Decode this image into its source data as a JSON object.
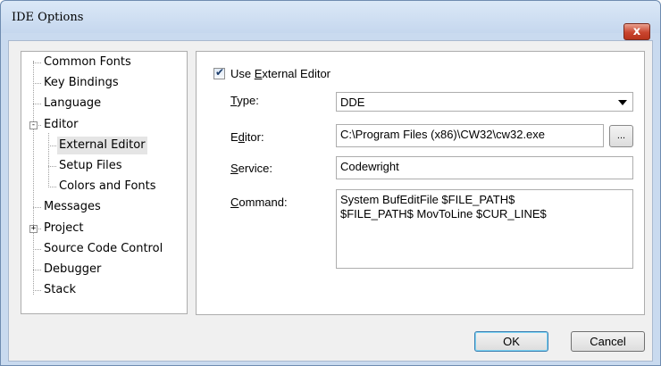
{
  "window": {
    "title": "IDE Options",
    "close_label": "x"
  },
  "tree": {
    "items": [
      {
        "label": "Common Fonts",
        "level": 0,
        "expander": ""
      },
      {
        "label": "Key Bindings",
        "level": 0,
        "expander": ""
      },
      {
        "label": "Language",
        "level": 0,
        "expander": ""
      },
      {
        "label": "Editor",
        "level": 0,
        "expander": "-"
      },
      {
        "label": "External Editor",
        "level": 1,
        "expander": "",
        "selected": true
      },
      {
        "label": "Setup Files",
        "level": 1,
        "expander": ""
      },
      {
        "label": "Colors and Fonts",
        "level": 1,
        "expander": ""
      },
      {
        "label": "Messages",
        "level": 0,
        "expander": ""
      },
      {
        "label": "Project",
        "level": 0,
        "expander": "+"
      },
      {
        "label": "Source Code Control",
        "level": 0,
        "expander": ""
      },
      {
        "label": "Debugger",
        "level": 0,
        "expander": ""
      },
      {
        "label": "Stack",
        "level": 0,
        "expander": ""
      }
    ]
  },
  "panel": {
    "use_external_editor": {
      "label_pre": "Use ",
      "label_accel": "E",
      "label_post": "xternal Editor",
      "checked": true,
      "check_glyph": "✔"
    },
    "type": {
      "label_pre": "",
      "label_accel": "T",
      "label_post": "ype:",
      "value": "DDE"
    },
    "editor": {
      "label_pre": "E",
      "label_accel": "d",
      "label_post": "itor:",
      "value": "C:\\Program Files (x86)\\CW32\\cw32.exe",
      "browse_label": "..."
    },
    "service": {
      "label_pre": "",
      "label_accel": "S",
      "label_post": "ervice:",
      "value": "Codewright"
    },
    "command": {
      "label_pre": "",
      "label_accel": "C",
      "label_post": "ommand:",
      "line1": "System BufEditFile $FILE_PATH$",
      "line2": "$FILE_PATH$ MovToLine $CUR_LINE$"
    }
  },
  "buttons": {
    "ok": "OK",
    "cancel": "Cancel"
  },
  "colors": {
    "titlebar": "#c5d7ee",
    "close_button": "#c9452e",
    "selected_item": "#e5e5e5",
    "default_button_border": "#3c7fb1"
  }
}
